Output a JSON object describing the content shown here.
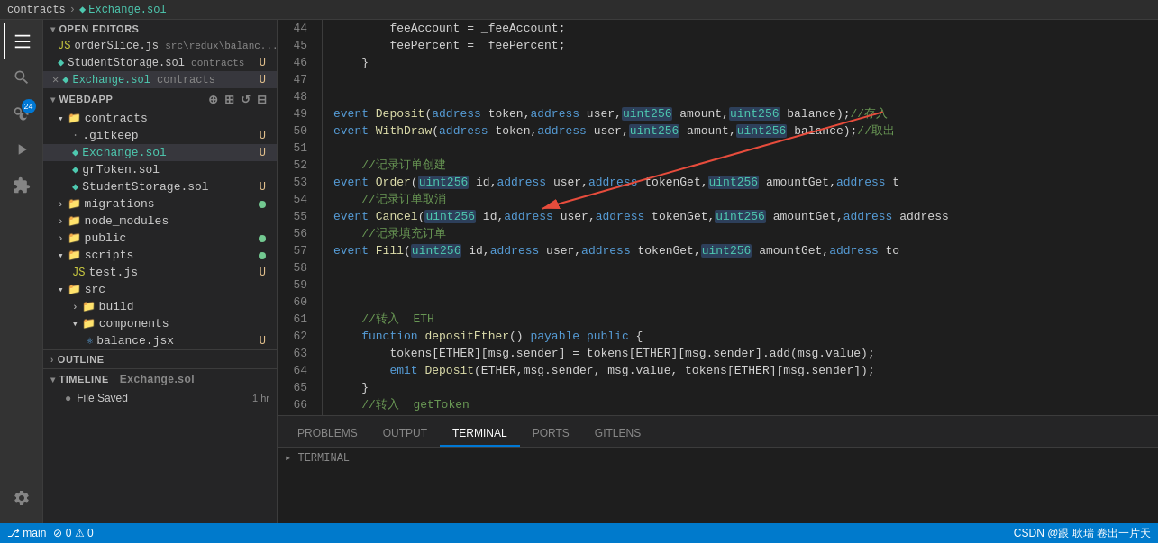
{
  "topbar": {
    "breadcrumb": [
      "contracts",
      "Exchange.sol"
    ]
  },
  "tabs": {
    "active": "Exchange.sol"
  },
  "sidebar": {
    "open_editors_label": "OPEN EDITORS",
    "editors": [
      {
        "name": "orderSlice.js",
        "path": "src\\redux\\balanc...",
        "type": "js",
        "badge": "U"
      },
      {
        "name": "StudentStorage.sol",
        "path": "contracts",
        "type": "sol",
        "badge": "U"
      },
      {
        "name": "Exchange.sol",
        "path": "contracts",
        "type": "sol",
        "badge": "U",
        "active": true,
        "closeable": true
      }
    ],
    "webdapp_label": "WEBDAPP",
    "tree": [
      {
        "label": "contracts",
        "type": "folder",
        "expanded": true,
        "indent": 0
      },
      {
        "label": ".gitkeep",
        "type": "file-dot",
        "indent": 1,
        "badge": "U"
      },
      {
        "label": "Exchange.sol",
        "type": "sol",
        "indent": 1,
        "badge": "U",
        "active": true
      },
      {
        "label": "grToken.sol",
        "type": "sol",
        "indent": 1,
        "badge": ""
      },
      {
        "label": "StudentStorage.sol",
        "type": "sol",
        "indent": 1,
        "badge": "U"
      },
      {
        "label": "migrations",
        "type": "folder",
        "indent": 0,
        "dot": true
      },
      {
        "label": "node_modules",
        "type": "folder",
        "indent": 0
      },
      {
        "label": "public",
        "type": "folder",
        "indent": 0,
        "dot": true
      },
      {
        "label": "scripts",
        "type": "folder",
        "indent": 0,
        "expanded": true,
        "dot": true
      },
      {
        "label": "test.js",
        "type": "js",
        "indent": 1,
        "badge": "U"
      },
      {
        "label": "src",
        "type": "folder",
        "indent": 0,
        "expanded": true
      },
      {
        "label": "build",
        "type": "folder",
        "indent": 1
      },
      {
        "label": "components",
        "type": "folder",
        "indent": 1,
        "expanded": true
      },
      {
        "label": "balance.jsx",
        "type": "jsx",
        "indent": 2,
        "badge": "U"
      }
    ],
    "outline_label": "OUTLINE",
    "timeline_label": "TIMELINE",
    "timeline_file": "Exchange.sol",
    "timeline_items": [
      {
        "label": "File Saved",
        "time": "1 hr"
      }
    ]
  },
  "editor": {
    "lines": [
      {
        "num": 44,
        "code": [
          {
            "t": "        feeAccount = _feeAccount;",
            "c": "plain"
          }
        ]
      },
      {
        "num": 45,
        "code": [
          {
            "t": "        feePercent = _feePercent;",
            "c": "plain"
          }
        ]
      },
      {
        "num": 46,
        "code": [
          {
            "t": "    }",
            "c": "plain"
          }
        ]
      },
      {
        "num": 47,
        "code": []
      },
      {
        "num": 48,
        "code": []
      },
      {
        "num": 49,
        "code": [
          {
            "t": "event ",
            "c": "kw"
          },
          {
            "t": "Deposit",
            "c": "fn"
          },
          {
            "t": "(",
            "c": "punc"
          },
          {
            "t": "address",
            "c": "kw"
          },
          {
            "t": " token,",
            "c": "plain"
          },
          {
            "t": "address",
            "c": "kw"
          },
          {
            "t": " user,",
            "c": "plain"
          },
          {
            "t": "uint256",
            "c": "type-hl"
          },
          {
            "t": " amount,",
            "c": "plain"
          },
          {
            "t": "uint256",
            "c": "type-hl"
          },
          {
            "t": " balance);",
            "c": "plain"
          },
          {
            "t": "//存入",
            "c": "comment"
          }
        ]
      },
      {
        "num": 50,
        "code": [
          {
            "t": "event ",
            "c": "kw"
          },
          {
            "t": "WithDraw",
            "c": "fn"
          },
          {
            "t": "(",
            "c": "punc"
          },
          {
            "t": "address",
            "c": "kw"
          },
          {
            "t": " token,",
            "c": "plain"
          },
          {
            "t": "address",
            "c": "kw"
          },
          {
            "t": " user,",
            "c": "plain"
          },
          {
            "t": "uint256",
            "c": "type-hl"
          },
          {
            "t": " amount,",
            "c": "plain"
          },
          {
            "t": "uint256",
            "c": "type-hl"
          },
          {
            "t": " balance);",
            "c": "plain"
          },
          {
            "t": "//取出",
            "c": "comment"
          }
        ]
      },
      {
        "num": 51,
        "code": []
      },
      {
        "num": 52,
        "code": [
          {
            "t": "    //记录订单创建",
            "c": "comment"
          }
        ]
      },
      {
        "num": 53,
        "code": [
          {
            "t": "event ",
            "c": "kw"
          },
          {
            "t": "Order",
            "c": "fn"
          },
          {
            "t": "(",
            "c": "punc"
          },
          {
            "t": "uint256",
            "c": "type-hl"
          },
          {
            "t": " id,",
            "c": "plain"
          },
          {
            "t": "address",
            "c": "kw"
          },
          {
            "t": " user,",
            "c": "plain"
          },
          {
            "t": "address",
            "c": "kw"
          },
          {
            "t": " tokenGet,",
            "c": "plain"
          },
          {
            "t": "uint256",
            "c": "type-hl"
          },
          {
            "t": " amountGet,",
            "c": "plain"
          },
          {
            "t": "address",
            "c": "kw"
          },
          {
            "t": " t",
            "c": "plain"
          }
        ]
      },
      {
        "num": 54,
        "code": [
          {
            "t": "    //记录订单取消",
            "c": "comment"
          }
        ]
      },
      {
        "num": 55,
        "code": [
          {
            "t": "event ",
            "c": "kw"
          },
          {
            "t": "Cancel",
            "c": "fn"
          },
          {
            "t": "(",
            "c": "punc"
          },
          {
            "t": "uint256",
            "c": "type-hl"
          },
          {
            "t": " id,",
            "c": "plain"
          },
          {
            "t": "address",
            "c": "kw"
          },
          {
            "t": " user,",
            "c": "plain"
          },
          {
            "t": "address",
            "c": "kw"
          },
          {
            "t": " tokenGet,",
            "c": "plain"
          },
          {
            "t": "uint256",
            "c": "type-hl"
          },
          {
            "t": " amountGet,",
            "c": "plain"
          },
          {
            "t": "address",
            "c": "kw"
          },
          {
            "t": " address",
            "c": "plain"
          }
        ]
      },
      {
        "num": 56,
        "code": [
          {
            "t": "    //记录填充订单",
            "c": "comment"
          }
        ]
      },
      {
        "num": 57,
        "code": [
          {
            "t": "event ",
            "c": "kw"
          },
          {
            "t": "Fill",
            "c": "fn"
          },
          {
            "t": "(",
            "c": "punc"
          },
          {
            "t": "uint256",
            "c": "type-hl"
          },
          {
            "t": " id,",
            "c": "plain"
          },
          {
            "t": "address",
            "c": "kw"
          },
          {
            "t": " user,",
            "c": "plain"
          },
          {
            "t": "address",
            "c": "kw"
          },
          {
            "t": " tokenGet,",
            "c": "plain"
          },
          {
            "t": "uint256",
            "c": "type-hl"
          },
          {
            "t": " amountGet,",
            "c": "plain"
          },
          {
            "t": "address",
            "c": "kw"
          },
          {
            "t": " to",
            "c": "plain"
          }
        ]
      },
      {
        "num": 58,
        "code": []
      },
      {
        "num": 59,
        "code": []
      },
      {
        "num": 60,
        "code": []
      },
      {
        "num": 61,
        "code": [
          {
            "t": "    //转入  ETH",
            "c": "comment"
          }
        ]
      },
      {
        "num": 62,
        "code": [
          {
            "t": "    function ",
            "c": "kw"
          },
          {
            "t": "depositEther",
            "c": "fn"
          },
          {
            "t": "() ",
            "c": "plain"
          },
          {
            "t": "payable",
            "c": "kw"
          },
          {
            "t": " ",
            "c": "plain"
          },
          {
            "t": "public",
            "c": "kw"
          },
          {
            "t": " {",
            "c": "plain"
          }
        ]
      },
      {
        "num": 63,
        "code": [
          {
            "t": "        tokens[ETHER][msg.sender] = tokens[ETHER][msg.sender].add(msg.value);",
            "c": "plain"
          }
        ]
      },
      {
        "num": 64,
        "code": [
          {
            "t": "        emit ",
            "c": "kw"
          },
          {
            "t": "Deposit",
            "c": "fn"
          },
          {
            "t": "(ETHER,msg.sender, msg.value, tokens[ETHER][msg.sender]);",
            "c": "plain"
          }
        ]
      },
      {
        "num": 65,
        "code": [
          {
            "t": "    }",
            "c": "plain"
          }
        ]
      },
      {
        "num": 66,
        "code": [
          {
            "t": "    //转入  getToken",
            "c": "comment"
          }
        ]
      }
    ]
  },
  "panel": {
    "tabs": [
      "PROBLEMS",
      "OUTPUT",
      "TERMINAL",
      "PORTS",
      "GITLENS"
    ],
    "active_tab": "TERMINAL"
  },
  "statusbar": {
    "left": [],
    "right": "CSDN @跟 耿瑞 卷出一片天"
  }
}
